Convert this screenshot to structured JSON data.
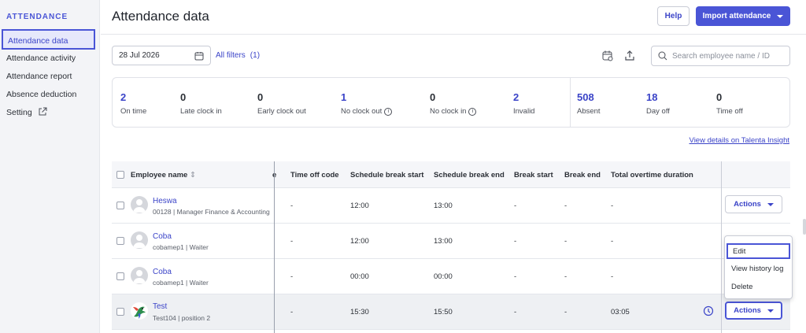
{
  "sidebar": {
    "heading": "ATTENDANCE",
    "items": [
      {
        "label": "Attendance data"
      },
      {
        "label": "Attendance activity"
      },
      {
        "label": "Attendance report"
      },
      {
        "label": "Absence deduction"
      },
      {
        "label": "Setting"
      }
    ]
  },
  "header": {
    "title": "Attendance data",
    "help_label": "Help",
    "import_label": "Import attendance"
  },
  "toolbar": {
    "date_value": "28 Jul 2026",
    "filters_label": "All filters",
    "filters_count": "(1)",
    "search_placeholder": "Search employee name / ID"
  },
  "stats": [
    {
      "value": "2",
      "label": "On time"
    },
    {
      "value": "0",
      "label": "Late clock in"
    },
    {
      "value": "0",
      "label": "Early clock out"
    },
    {
      "value": "1",
      "label": "No clock out"
    },
    {
      "value": "0",
      "label": "No clock in"
    },
    {
      "value": "2",
      "label": "Invalid"
    },
    {
      "value": "508",
      "label": "Absent"
    },
    {
      "value": "18",
      "label": "Day off"
    },
    {
      "value": "0",
      "label": "Time off"
    }
  ],
  "insight_link": "View details on Talenta Insight",
  "table": {
    "columns": {
      "employee": "Employee name",
      "truncated": "e",
      "time_off_code": "Time off code",
      "schedule_break_start": "Schedule break start",
      "schedule_break_end": "Schedule break end",
      "break_start": "Break start",
      "break_end": "Break end",
      "total_overtime": "Total overtime duration"
    },
    "rows": [
      {
        "name": "Heswa",
        "sub": "00128 | Manager Finance & Accounting",
        "time_off_code": "-",
        "sched_break_start": "12:00",
        "sched_break_end": "13:00",
        "break_start": "-",
        "break_end": "-",
        "overtime": "-",
        "action": "Actions"
      },
      {
        "name": "Coba",
        "sub": "cobamep1 | Waiter",
        "time_off_code": "-",
        "sched_break_start": "12:00",
        "sched_break_end": "13:00",
        "break_start": "-",
        "break_end": "-",
        "overtime": "-",
        "action": ""
      },
      {
        "name": "Coba",
        "sub": "cobamep1 | Waiter",
        "time_off_code": "-",
        "sched_break_start": "00:00",
        "sched_break_end": "00:00",
        "break_start": "-",
        "break_end": "-",
        "overtime": "-",
        "action": ""
      },
      {
        "name": "Test",
        "sub": "Test104 | position 2",
        "time_off_code": "-",
        "sched_break_start": "15:30",
        "sched_break_end": "15:50",
        "break_start": "-",
        "break_end": "-",
        "overtime": "03:05",
        "action": "Actions"
      }
    ]
  },
  "dropdown": {
    "items": [
      {
        "label": "Edit"
      },
      {
        "label": "View history log"
      },
      {
        "label": "Delete"
      }
    ]
  },
  "colors": {
    "accent": "#4a55d6",
    "link": "#3b44c8"
  }
}
